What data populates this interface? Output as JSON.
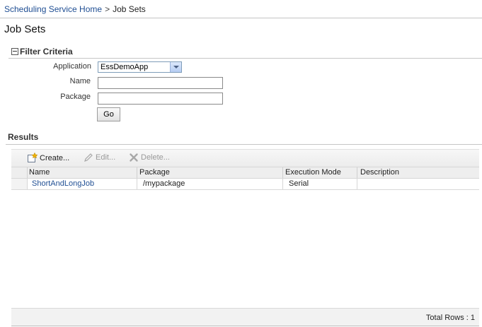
{
  "breadcrumb": {
    "home_link": "Scheduling Service Home",
    "separator": ">",
    "current": "Job Sets"
  },
  "page_title": "Job Sets",
  "filter": {
    "section_title": "Filter Criteria",
    "application_label": "Application",
    "application_value": "EssDemoApp",
    "name_label": "Name",
    "name_value": "",
    "package_label": "Package",
    "package_value": "",
    "go_label": "Go"
  },
  "results": {
    "title": "Results",
    "toolbar": {
      "create_label": "Create...",
      "edit_label": "Edit...",
      "delete_label": "Delete..."
    },
    "columns": [
      "Name",
      "Package",
      "Execution Mode",
      "Description"
    ],
    "rows": [
      {
        "name": "ShortAndLongJob",
        "package": "/mypackage",
        "execution_mode": "Serial",
        "description": ""
      }
    ],
    "total_rows": "Total Rows : 1"
  },
  "colors": {
    "link": "#1f4e93",
    "divider": "#c5c5c5",
    "header_bg": "#eeeeee"
  }
}
